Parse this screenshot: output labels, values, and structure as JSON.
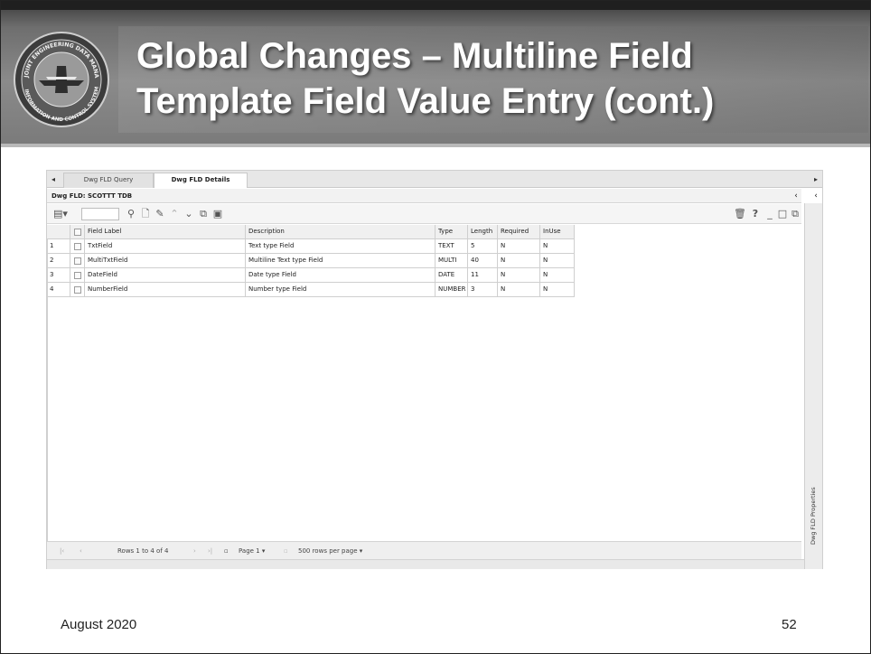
{
  "slide": {
    "title_line1": "Global Changes – Multiline Field",
    "title_line2": "Template Field Value Entry (cont.)",
    "footer_date": "August 2020",
    "page_number": "52",
    "logo_text_top": "JOINT ENGINEERING DATA MANAGEMENT",
    "logo_text_bottom": "INFORMATION AND CONTROL SYSTEM"
  },
  "app": {
    "tabs": [
      {
        "label": "Dwg FLD Query",
        "active": false
      },
      {
        "label": "Dwg FLD Details",
        "active": true
      }
    ],
    "panel_title": "Dwg FLD: SCOTTT TDB",
    "side_panel_label": "Dwg FLD Properties",
    "toolbar": {
      "search_placeholder": "",
      "help_label": "?"
    },
    "grid": {
      "columns": [
        "",
        "",
        "Field Label",
        "Description",
        "Type",
        "Length",
        "Required",
        "InUse"
      ],
      "rows": [
        {
          "num": "1",
          "label": "TxtField",
          "description": "Text type Field",
          "type": "TEXT",
          "length": "5",
          "required": "N",
          "inuse": "N"
        },
        {
          "num": "2",
          "label": "MultiTxtField",
          "description": "Multiline Text type Field",
          "type": "MULTI",
          "length": "40",
          "required": "N",
          "inuse": "N"
        },
        {
          "num": "3",
          "label": "DateField",
          "description": "Date type Field",
          "type": "DATE",
          "length": "11",
          "required": "N",
          "inuse": "N"
        },
        {
          "num": "4",
          "label": "NumberField",
          "description": "Number type Field",
          "type": "NUMBER",
          "length": "3",
          "required": "N",
          "inuse": "N"
        }
      ]
    },
    "pager": {
      "rows_info": "Rows 1 to 4 of 4",
      "page_label": "Page 1",
      "rows_per_page": "500 rows per page"
    }
  },
  "colors": {
    "title_band": "#8a8a8a",
    "title_text": "#ffffff"
  }
}
